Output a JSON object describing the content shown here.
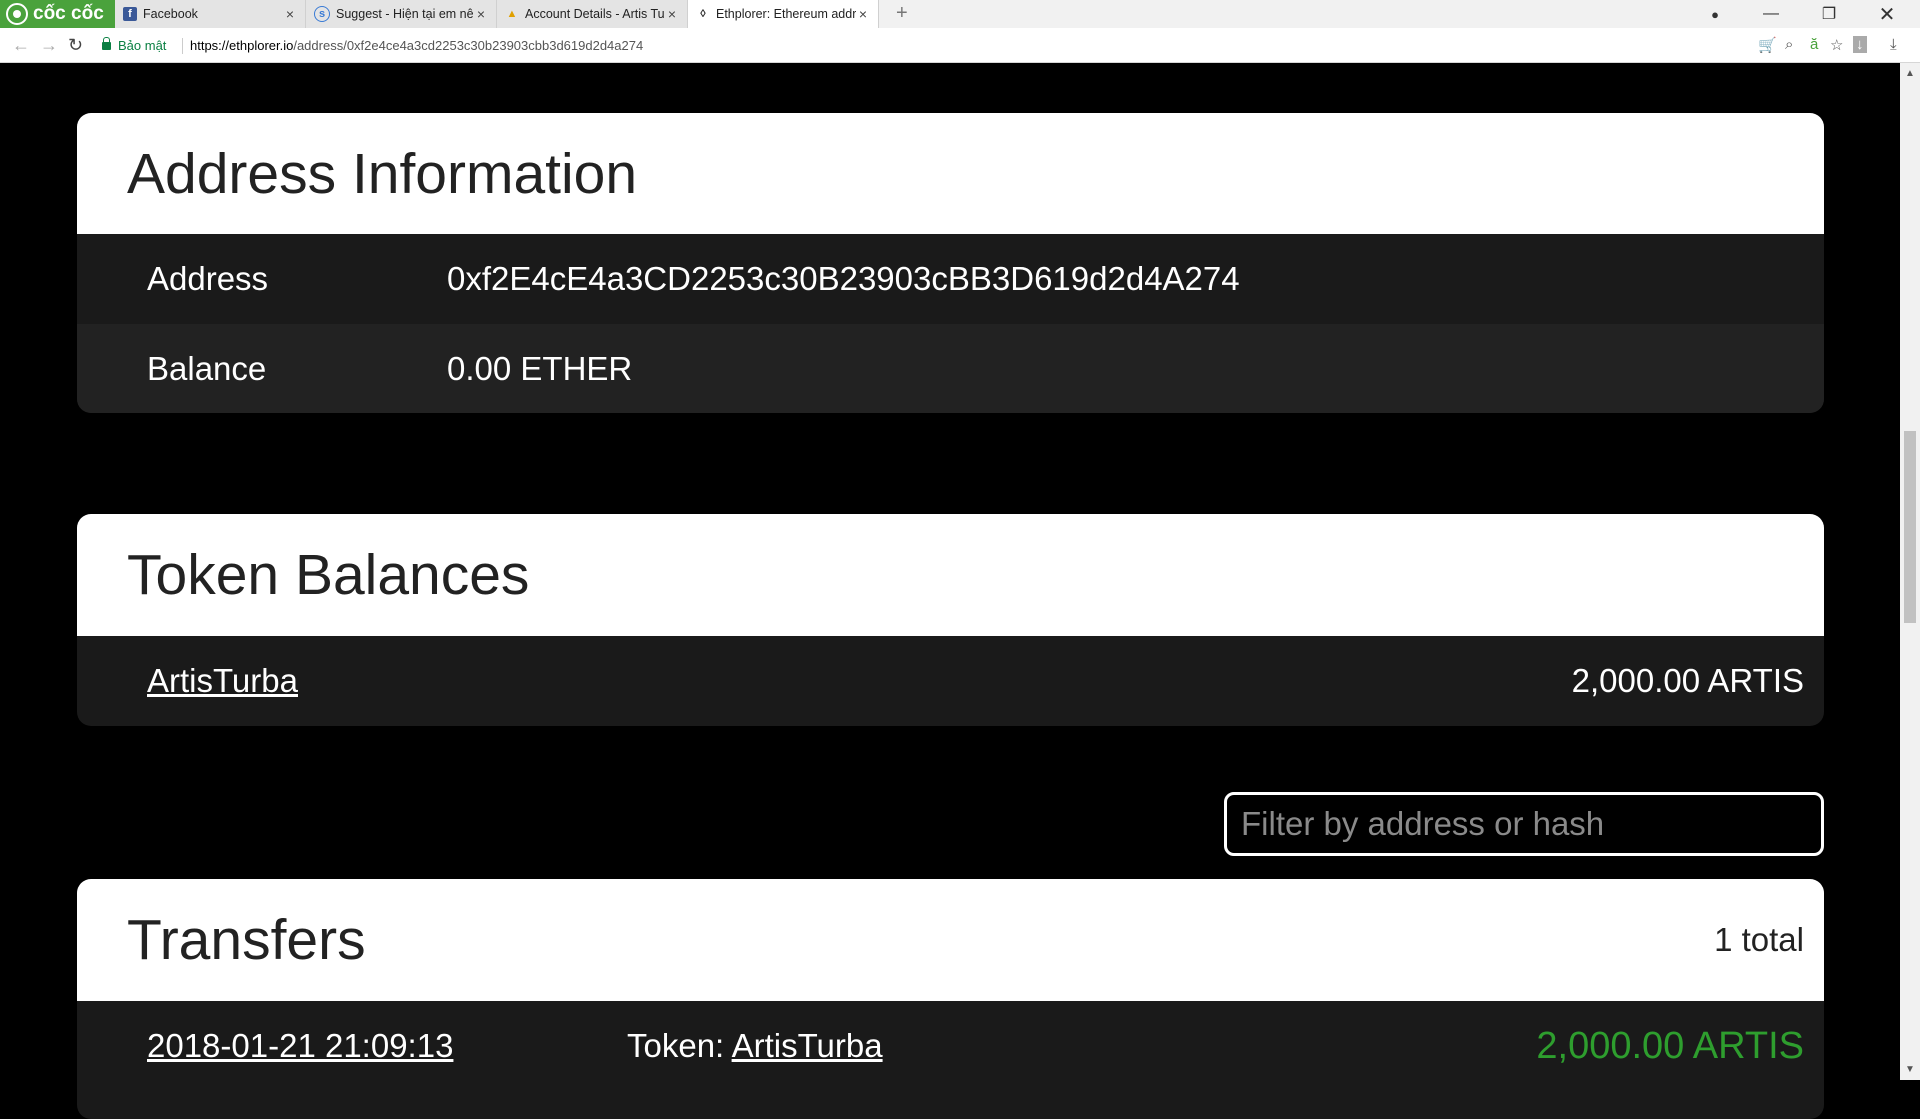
{
  "browser": {
    "brand": "cốc cốc",
    "tabs": [
      {
        "title": "Facebook",
        "favicon": "facebook-icon"
      },
      {
        "title": "Suggest - Hiện tại em nên",
        "favicon": "globe-icon"
      },
      {
        "title": "Account Details - Artis Tur",
        "favicon": "artis-icon"
      },
      {
        "title": "Ethplorer: Ethereum addre",
        "favicon": "ethereum-icon"
      }
    ],
    "secure_label": "Bảo mật",
    "url_host": "https://ethplorer.io",
    "url_path": "/address/0xf2e4ce4a3cd2253c30b23903cbb3d619d2d4a274"
  },
  "address_info": {
    "title": "Address Information",
    "address_label": "Address",
    "address_value": "0xf2E4cE4a3CD2253c30B23903cBB3D619d2d4A274",
    "balance_label": "Balance",
    "balance_value": "0.00 ETHER"
  },
  "token_balances": {
    "title": "Token Balances",
    "items": [
      {
        "name": "ArtisTurba",
        "amount": "2,000.00 ARTIS"
      }
    ]
  },
  "filter": {
    "placeholder": "Filter by address or hash"
  },
  "transfers": {
    "title": "Transfers",
    "total": "1 total",
    "rows": [
      {
        "date": "2018-01-21 21:09:13",
        "token_label": "Token:",
        "token_name": "ArtisTurba",
        "amount": "2,000.00 ARTIS"
      }
    ]
  },
  "colors": {
    "page_bg": "#000000",
    "panel_head_bg": "#ffffff",
    "row_bg": "#1a1a1a",
    "incoming_amount": "#2e9e2e",
    "brand_green": "#4aa23c"
  }
}
